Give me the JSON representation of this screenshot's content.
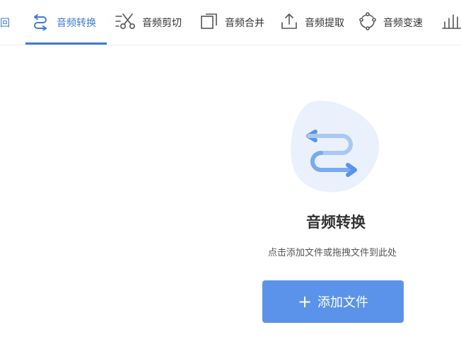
{
  "toolbar": {
    "back_label": "返回",
    "tabs": [
      {
        "label": "音频转换",
        "icon": "convert-arrows-icon",
        "active": true
      },
      {
        "label": "音频剪切",
        "icon": "scissors-icon",
        "active": false
      },
      {
        "label": "音频合并",
        "icon": "merge-icon",
        "active": false
      },
      {
        "label": "音频提取",
        "icon": "upload-extract-icon",
        "active": false
      },
      {
        "label": "音频变速",
        "icon": "speed-circle-icon",
        "active": false
      },
      {
        "label": "",
        "icon": "bar-chart-icon",
        "active": false
      }
    ]
  },
  "main": {
    "title": "音频转换",
    "hint": "点击添加文件或拖拽文件到此处",
    "add_button_icon": "+",
    "add_button_label": "添加文件"
  },
  "colors": {
    "accent": "#3f7ad8",
    "button": "#5b93ea",
    "hero_bg": "#eaf1fc"
  }
}
